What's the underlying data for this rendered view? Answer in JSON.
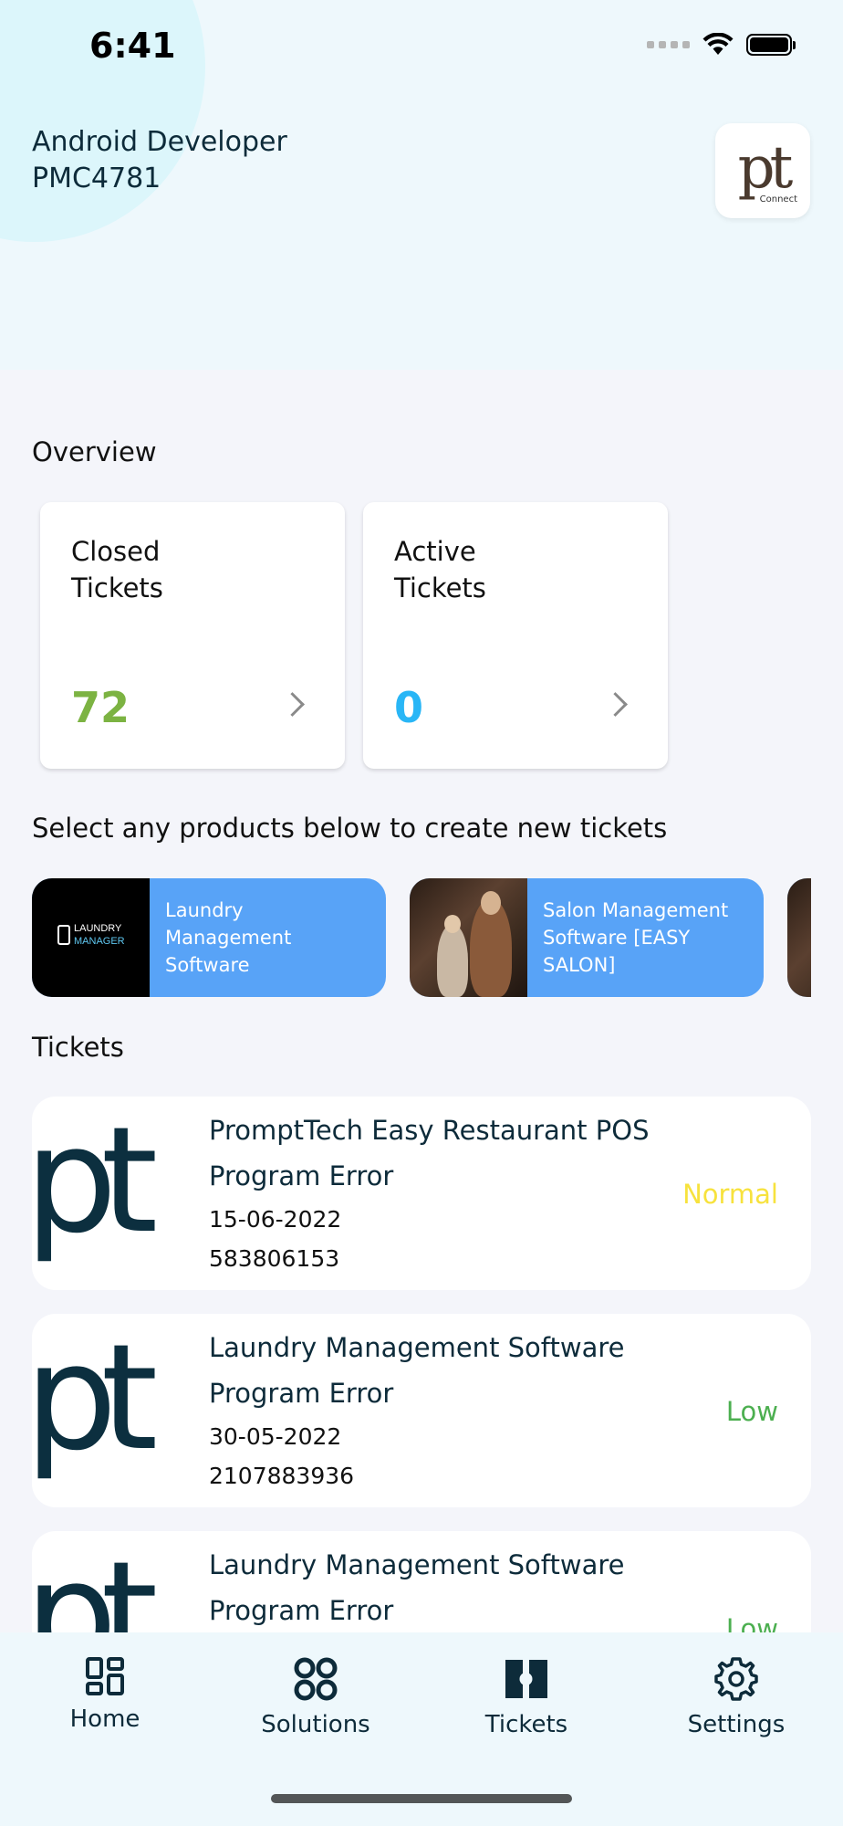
{
  "status_bar": {
    "time": "6:41"
  },
  "header": {
    "user_name": "Android Developer",
    "user_code": "PMC4781",
    "logo_text": "pt",
    "logo_subtext": "Connect"
  },
  "overview": {
    "title": "Overview",
    "cards": [
      {
        "label": "Closed Tickets",
        "value": "72",
        "value_color": "#7cb342"
      },
      {
        "label": "Active Tickets",
        "value": "0",
        "value_color": "#29b6f6"
      }
    ]
  },
  "products": {
    "title": "Select any products below to create new tickets",
    "items": [
      {
        "name": "Laundry Management Software",
        "thumb_text": [
          "LAUNDRY",
          "MANAGER"
        ]
      },
      {
        "name": "Salon Management Software [EASY SALON]"
      }
    ]
  },
  "tickets": {
    "title": "Tickets",
    "items": [
      {
        "product": "PromptTech Easy Restaurant POS",
        "type": "Program Error",
        "date": "15-06-2022",
        "id": "583806153",
        "priority": "Normal",
        "priority_color": "#f7e23d",
        "logo_text": "pt"
      },
      {
        "product": "Laundry Management Software",
        "type": "Program Error",
        "date": "30-05-2022",
        "id": "2107883936",
        "priority": "Low",
        "priority_color": "#4caf50",
        "logo_text": "pt"
      },
      {
        "product": "Laundry Management Software",
        "type": "Program Error",
        "priority": "Low",
        "priority_color": "#4caf50",
        "logo_text": "pt"
      }
    ]
  },
  "bottom_nav": {
    "items": [
      {
        "label": "Home",
        "icon": "home-icon"
      },
      {
        "label": "Solutions",
        "icon": "solutions-icon"
      },
      {
        "label": "Tickets",
        "icon": "tickets-icon"
      },
      {
        "label": "Settings",
        "icon": "gear-icon"
      }
    ]
  }
}
